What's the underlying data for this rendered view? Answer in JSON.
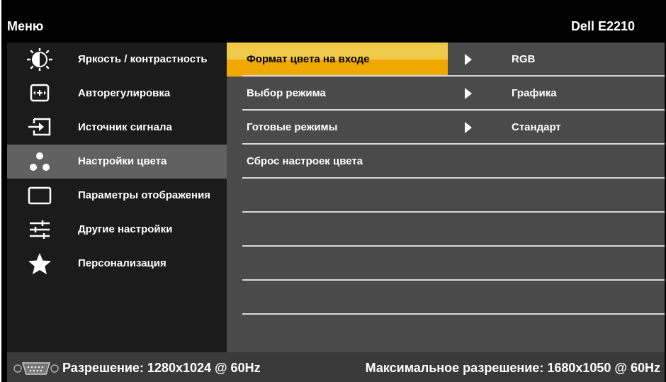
{
  "header": {
    "title": "Меню",
    "model": "Dell E2210"
  },
  "sidebar": {
    "items": [
      {
        "label": "Яркость / контрастность",
        "icon": "brightness-icon"
      },
      {
        "label": "Авторегулировка",
        "icon": "auto-adjust-icon"
      },
      {
        "label": "Источник сигнала",
        "icon": "input-source-icon"
      },
      {
        "label": "Настройки цвета",
        "icon": "color-settings-icon",
        "active": true
      },
      {
        "label": "Параметры отображения",
        "icon": "display-settings-icon"
      },
      {
        "label": "Другие настройки",
        "icon": "other-settings-icon"
      },
      {
        "label": "Персонализация",
        "icon": "star-icon"
      }
    ]
  },
  "content": {
    "rows": [
      {
        "label": "Формат цвета на входе",
        "value": "RGB",
        "selected": true
      },
      {
        "label": "Выбор режима",
        "value": "Графика"
      },
      {
        "label": "Готовые режимы",
        "value": "Стандарт"
      },
      {
        "label": "Сброс настроек цвета",
        "value": ""
      }
    ]
  },
  "footer": {
    "resolution": "Разрешение: 1280x1024 @ 60Hz",
    "max_resolution": "Максимальное разрешение: 1680x1050 @ 60Hz",
    "icon": "vga-connector-icon"
  },
  "colors": {
    "highlight_top": "#f0c84a",
    "highlight_bottom": "#f0a800",
    "active_item": "#616161"
  }
}
